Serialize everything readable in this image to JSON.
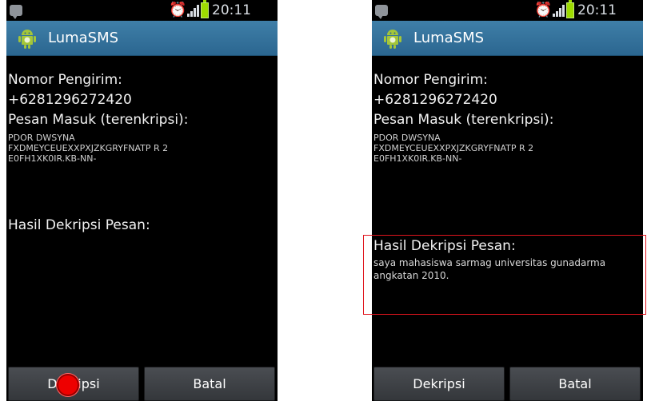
{
  "screens": [
    {
      "status": {
        "time": "20:11"
      },
      "app_title": "LumaSMS",
      "sender_label": "Nomor Pengirim:",
      "sender_number": "+6281296272420",
      "encrypted_label": "Pesan Masuk (terenkripsi):",
      "encrypted_text": "PDOR DWSYNA\nFXDMEYCEUEXXPXJZKGRYFNATP R 2\nE0FH1XK0IR.KB-NN-",
      "decrypt_label": "Hasil Dekripsi Pesan:",
      "decrypt_result": "",
      "buttons": {
        "decrypt": "Dekripsi",
        "cancel": "Batal"
      }
    },
    {
      "status": {
        "time": "20:11"
      },
      "app_title": "LumaSMS",
      "sender_label": "Nomor Pengirim:",
      "sender_number": "+6281296272420",
      "encrypted_label": "Pesan Masuk (terenkripsi):",
      "encrypted_text": "PDOR DWSYNA\nFXDMEYCEUEXXPXJZKGRYFNATP R 2\nE0FH1XK0IR.KB-NN-",
      "decrypt_label": "Hasil Dekripsi Pesan:",
      "decrypt_result": "saya mahasiswa sarmag universitas gunadarma angkatan 2010.",
      "buttons": {
        "decrypt": "Dekripsi",
        "cancel": "Batal"
      }
    }
  ],
  "annotations": {
    "tap_marker_color": "#ee0000",
    "highlight_color": "#e0141d"
  },
  "icons": {
    "notification": "message-icon",
    "alarm": "alarm-clock-icon",
    "signal": "signal-strength-icon",
    "battery": "battery-icon",
    "app": "android-robot-icon"
  }
}
